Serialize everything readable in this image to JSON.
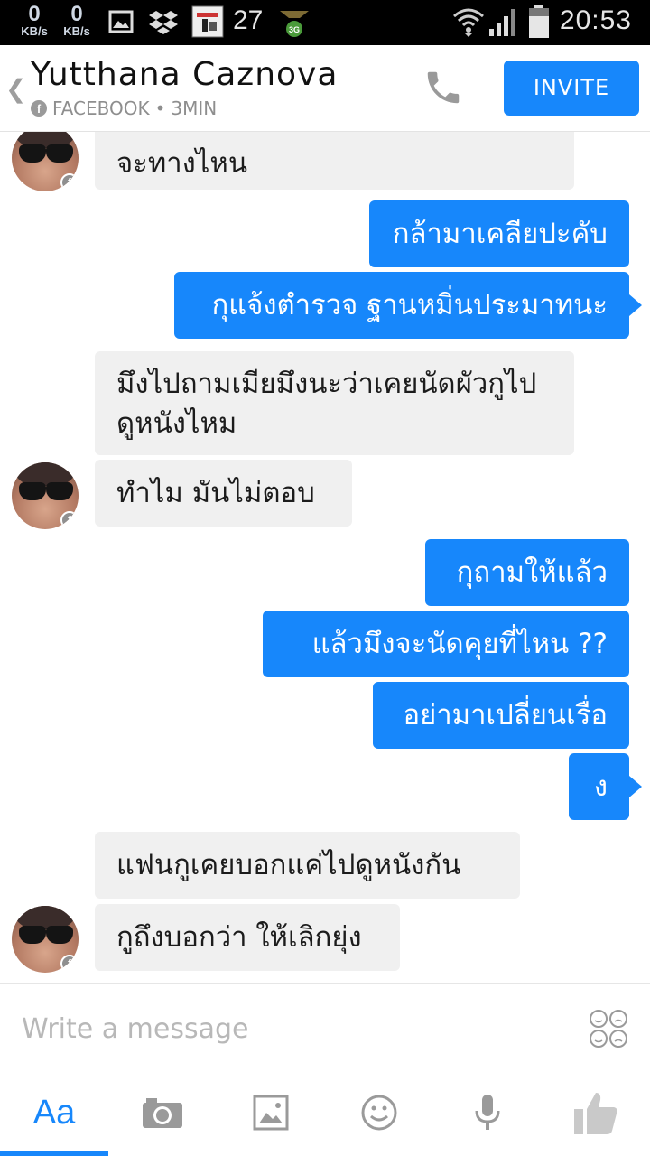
{
  "status_bar": {
    "net_down": "0",
    "net_up": "0",
    "net_unit": "KB/s",
    "notification_count": "27",
    "time": "20:53"
  },
  "header": {
    "contact_name": "Yutthana Caznova",
    "source": "FACEBOOK",
    "separator": "•",
    "last_active": "3MIN",
    "invite_label": "INVITE"
  },
  "messages": [
    {
      "from": "them",
      "text": "จะทางไหน"
    },
    {
      "from": "me",
      "text": "กล้ามาเคลียปะคับ"
    },
    {
      "from": "me",
      "text": "กุแจ้งตำรวจ ฐานหมิ่นประมาทนะ"
    },
    {
      "from": "them",
      "text": "มึงไปถามเมียมึงนะว่าเคยนัดผัวกูไปดูหนังไหม"
    },
    {
      "from": "them",
      "text": "ทำไม มันไม่ตอบ"
    },
    {
      "from": "me",
      "text": "กุถามให้แล้ว"
    },
    {
      "from": "me",
      "text": "แล้วมึงจะนัดคุยที่ไหน ??"
    },
    {
      "from": "me",
      "text": "อย่ามาเปลี่ยนเรื่อ"
    },
    {
      "from": "me",
      "text": "ง"
    },
    {
      "from": "them",
      "text": "แฟนกูเคยบอกแค่ไปดูหนังกัน"
    },
    {
      "from": "them",
      "text": "กูถึงบอกว่า ให้เลิกยุ่ง"
    }
  ],
  "composer": {
    "placeholder": "Write a message"
  },
  "toolbar": {
    "text_tab_label": "Aa"
  },
  "colors": {
    "accent": "#1787fb",
    "incoming_bubble": "#f0f0f0",
    "status_bar": "#000000"
  }
}
